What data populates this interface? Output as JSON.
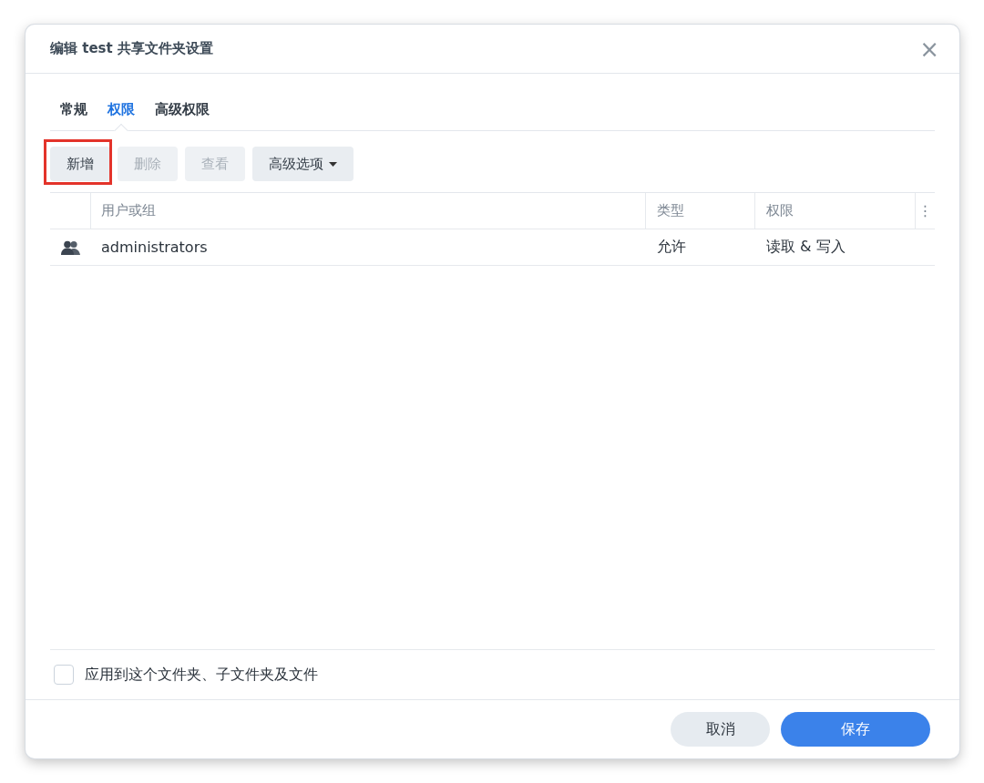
{
  "window": {
    "title": "编辑 test 共享文件夹设置",
    "close": "×"
  },
  "tabs": [
    {
      "label": "常规",
      "selected": false
    },
    {
      "label": "权限",
      "selected": true
    },
    {
      "label": "高级权限",
      "selected": false
    }
  ],
  "toolbar": [
    {
      "label": "新增",
      "disabled": false,
      "highlighted": true,
      "dropdown": false
    },
    {
      "label": "删除",
      "disabled": true,
      "highlighted": false,
      "dropdown": false
    },
    {
      "label": "查看",
      "disabled": true,
      "highlighted": false,
      "dropdown": false
    },
    {
      "label": "高级选项",
      "disabled": false,
      "highlighted": false,
      "dropdown": true
    }
  ],
  "table": {
    "columns": [
      "用户或组",
      "类型",
      "权限"
    ],
    "menu": "⋮",
    "rows": [
      {
        "kind": "group",
        "name": "administrators",
        "type": "允许",
        "permission": "读取 & 写入"
      }
    ]
  },
  "apply_option": {
    "label": "应用到这个文件夹、子文件夹及文件",
    "checked": false
  },
  "buttons": [
    {
      "label": "取消",
      "kind": "secondary"
    },
    {
      "label": "保存",
      "kind": "primary"
    }
  ]
}
